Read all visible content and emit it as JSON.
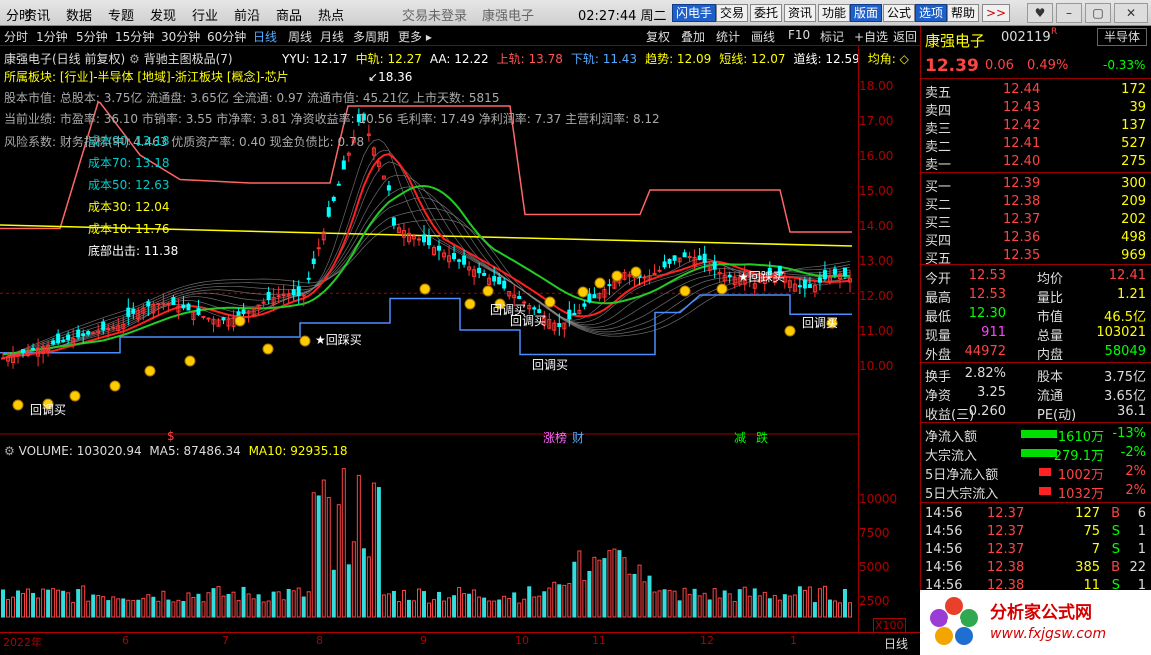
{
  "menubar": {
    "items": [
      "分时",
      "资讯",
      "数据",
      "专题",
      "发现",
      "行业",
      "前沿",
      "商品",
      "热点"
    ],
    "notice1": "交易未登录",
    "notice2": "康强电子",
    "clock": "02:27:44",
    "weekday": "周二",
    "tool_buttons": [
      "闪电手",
      "交易",
      "委托",
      "资讯",
      "功能",
      "版面",
      "公式",
      "选项",
      "帮助"
    ],
    "more": ">>"
  },
  "toolbar": {
    "tabs": [
      "分时",
      "1分钟",
      "5分钟",
      "15分钟",
      "30分钟",
      "60分钟",
      "日线",
      "周线",
      "月线",
      "多周期",
      "更多"
    ],
    "active_tab": "日线",
    "tools": [
      "复权",
      "叠加",
      "统计",
      "画线",
      "F10",
      "标记",
      "+自选",
      "返回"
    ]
  },
  "chart": {
    "title": "康强电子(日线 前复权)",
    "indicator": "背驰主图极品(7)",
    "legend": [
      {
        "t": "YYU: 12.17",
        "c": "#ffffff"
      },
      {
        "t": "中轨: 12.27",
        "c": "#ffff00"
      },
      {
        "t": "AA: 12.22",
        "c": "#ffffff"
      },
      {
        "t": "上轨: 13.78",
        "c": "#ff5555"
      },
      {
        "t": "下轨: 11.43",
        "c": "#55aaff"
      },
      {
        "t": "趋势: 12.09",
        "c": "#ffff00"
      },
      {
        "t": "短线: 12.07",
        "c": "#ffff00"
      },
      {
        "t": "道线: 12.59",
        "c": "#ffffff"
      },
      {
        "t": "均角: ◇",
        "c": "#ffff00"
      }
    ],
    "info_lines": [
      "所属板块: [行业]-半导体 [地域]-浙江板块 [概念]-芯片",
      "股本市值: 总股本: 3.75亿 流通盘: 3.65亿 全流通: 0.97 流通市值: 45.21亿 上市天数: 5815",
      "当前业绩: 市盈率: 36.10 市销率: 3.55 市净率: 3.81 净资收益率: 10.56 毛利率: 17.49 净利润率: 7.37 主营利润率: 8.12",
      "风险系数: 财务指标(中) 4.463 优质资产率: 0.40 现金负债比: 0.78"
    ],
    "costs": [
      "成本90: 13.18",
      "成本70: 13.18",
      "成本50: 12.63",
      "成本30: 12.04",
      "成本10: 11.76"
    ],
    "bottom_out": "底部出击: 11.38",
    "high_label": "18.36",
    "signals": [
      "★回踩买",
      "回调买",
      "回调买",
      "回调买",
      "回调买",
      "★回踩买",
      "回调买",
      "回调买"
    ],
    "events": [
      "$",
      "涨榜",
      "财",
      "减",
      "跌"
    ],
    "y_ticks": [
      "18.00",
      "17.00",
      "16.00",
      "15.00",
      "14.00",
      "13.00",
      "12.00",
      "11.00",
      "10.00"
    ],
    "volume_legend": {
      "title": "VOLUME: 103020.94",
      "ma5": "MA5: 87486.34",
      "ma10": "MA10: 92935.18"
    },
    "v_ticks": [
      "10000",
      "7500",
      "5000",
      "2500"
    ],
    "v_unit": "X100",
    "months": [
      "2022年",
      "6",
      "7",
      "8",
      "9",
      "10",
      "11",
      "12",
      "1"
    ],
    "period_label": "日线"
  },
  "quote": {
    "name": "康强电子",
    "code": "002119",
    "flag": "R",
    "sector_btn": "半导体",
    "sector_change": "-0.33%",
    "price": "12.39",
    "change": "0.06",
    "change_pct": "0.49%",
    "asks": [
      {
        "label": "卖五",
        "price": "12.44",
        "vol": "172"
      },
      {
        "label": "卖四",
        "price": "12.43",
        "vol": "39"
      },
      {
        "label": "卖三",
        "price": "12.42",
        "vol": "137"
      },
      {
        "label": "卖二",
        "price": "12.41",
        "vol": "527"
      },
      {
        "label": "卖一",
        "price": "12.40",
        "vol": "275"
      }
    ],
    "bids": [
      {
        "label": "买一",
        "price": "12.39",
        "vol": "300"
      },
      {
        "label": "买二",
        "price": "12.38",
        "vol": "209"
      },
      {
        "label": "买三",
        "price": "12.37",
        "vol": "202"
      },
      {
        "label": "买四",
        "price": "12.36",
        "vol": "498"
      },
      {
        "label": "买五",
        "price": "12.35",
        "vol": "969"
      }
    ],
    "stats": [
      {
        "l1": "今开",
        "v1": "12.53",
        "l2": "均价",
        "v2": "12.41"
      },
      {
        "l1": "最高",
        "v1": "12.53",
        "l2": "量比",
        "v2": "1.21"
      },
      {
        "l1": "最低",
        "v1": "12.30",
        "l2": "市值",
        "v2": "46.5亿"
      },
      {
        "l1": "现量",
        "v1": "911",
        "l2": "总量",
        "v2": "103021"
      },
      {
        "l1": "外盘",
        "v1": "44972",
        "l2": "内盘",
        "v2": "58049"
      }
    ],
    "stats2": [
      {
        "l1": "换手",
        "v1": "2.82%",
        "l2": "股本",
        "v2": "3.75亿"
      },
      {
        "l1": "净资",
        "v1": "3.25",
        "l2": "流通",
        "v2": "3.65亿"
      },
      {
        "l1": "收益(三)",
        "v1": "0.260",
        "l2": "PE(动)",
        "v2": "36.1"
      }
    ],
    "flows": [
      {
        "label": "净流入额",
        "value": "-1610万",
        "pct": "-13%",
        "dir": "down"
      },
      {
        "label": "大宗流入",
        "value": "-279.1万",
        "pct": "-2%",
        "dir": "down"
      },
      {
        "label": "5日净流入额",
        "value": "1002万",
        "pct": "2%",
        "dir": "up"
      },
      {
        "label": "5日大宗流入",
        "value": "1032万",
        "pct": "2%",
        "dir": "up"
      }
    ],
    "ticks": [
      {
        "time": "14:56",
        "price": "12.37",
        "vol": "127",
        "bs": "B",
        "n": "6"
      },
      {
        "time": "14:56",
        "price": "12.37",
        "vol": "75",
        "bs": "S",
        "n": "1"
      },
      {
        "time": "14:56",
        "price": "12.37",
        "vol": "7",
        "bs": "S",
        "n": "1"
      },
      {
        "time": "14:56",
        "price": "12.38",
        "vol": "385",
        "bs": "B",
        "n": "22"
      },
      {
        "time": "14:56",
        "price": "12.38",
        "vol": "11",
        "bs": "S",
        "n": "1"
      },
      {
        "time": "14"
      },
      {
        "time": "14"
      }
    ],
    "watermark": {
      "name": "分析家公式网",
      "url": "www.fxjgsw.com"
    }
  },
  "colors": {
    "up": "#ff3333",
    "down": "#00ffff",
    "ma_yellow": "#ffff00",
    "upper": "#ff6666",
    "lower": "#4a8dff"
  }
}
